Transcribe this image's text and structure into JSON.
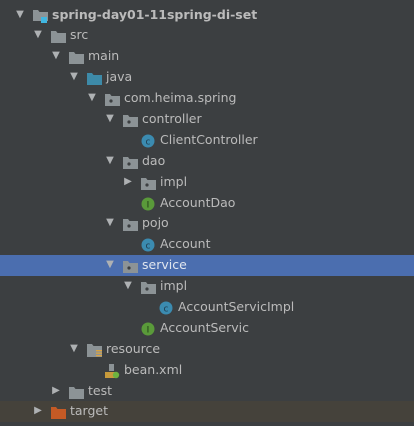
{
  "colors": {
    "background": "#3c3f41",
    "selection": "#4b6eaf",
    "text": "#bbbbbb",
    "folder": "#8c9396",
    "source_folder": "#3d8aa8",
    "excluded_folder": "#c55a25",
    "class": "#3b8bb0",
    "interface": "#5a9a3a"
  },
  "tree": [
    {
      "label": "spring-day01-11spring-di-set",
      "depth": 0,
      "state": "expanded",
      "icon": "module-folder-icon",
      "bold": true
    },
    {
      "label": "src",
      "depth": 1,
      "state": "expanded",
      "icon": "folder-icon"
    },
    {
      "label": "main",
      "depth": 2,
      "state": "expanded",
      "icon": "folder-icon"
    },
    {
      "label": "java",
      "depth": 3,
      "state": "expanded",
      "icon": "source-folder-icon"
    },
    {
      "label": "com.heima.spring",
      "depth": 4,
      "state": "expanded",
      "icon": "package-icon"
    },
    {
      "label": "controller",
      "depth": 5,
      "state": "expanded",
      "icon": "package-icon"
    },
    {
      "label": "ClientController",
      "depth": 6,
      "state": "leaf",
      "icon": "class-icon"
    },
    {
      "label": "dao",
      "depth": 5,
      "state": "expanded",
      "icon": "package-icon"
    },
    {
      "label": "impl",
      "depth": 6,
      "state": "collapsed",
      "icon": "package-icon"
    },
    {
      "label": "AccountDao",
      "depth": 6,
      "state": "leaf",
      "icon": "interface-icon"
    },
    {
      "label": "pojo",
      "depth": 5,
      "state": "expanded",
      "icon": "package-icon"
    },
    {
      "label": "Account",
      "depth": 6,
      "state": "leaf",
      "icon": "class-icon"
    },
    {
      "label": "service",
      "depth": 5,
      "state": "expanded",
      "icon": "package-icon",
      "selected": true
    },
    {
      "label": "impl",
      "depth": 6,
      "state": "expanded",
      "icon": "package-icon"
    },
    {
      "label": "AccountServicImpl",
      "depth": 7,
      "state": "leaf",
      "icon": "class-icon"
    },
    {
      "label": "AccountServic",
      "depth": 6,
      "state": "leaf",
      "icon": "interface-icon"
    },
    {
      "label": "resource",
      "depth": 3,
      "state": "expanded",
      "icon": "resource-folder-icon"
    },
    {
      "label": "bean.xml",
      "depth": 4,
      "state": "leaf",
      "icon": "spring-xml-icon"
    },
    {
      "label": "test",
      "depth": 2,
      "state": "collapsed",
      "icon": "folder-icon"
    },
    {
      "label": "target",
      "depth": 1,
      "state": "collapsed",
      "icon": "excluded-folder-icon",
      "excluded": true
    }
  ]
}
